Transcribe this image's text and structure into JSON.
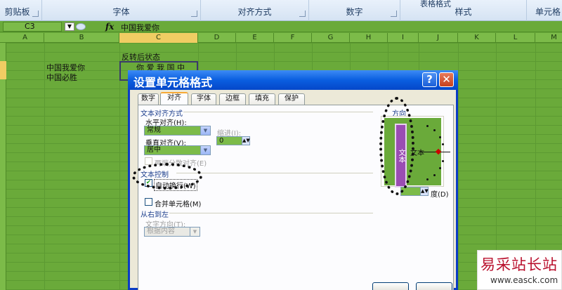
{
  "ribbon": {
    "groups": [
      "剪贴板",
      "字体",
      "对齐方式",
      "数字",
      "样式",
      "单元格"
    ],
    "top_partial": "表格格式"
  },
  "formula_bar": {
    "name_box": "C3",
    "fx": "fx",
    "content": "中国我爱你"
  },
  "columns": [
    "A",
    "B",
    "C",
    "D",
    "E",
    "F",
    "G",
    "H",
    "I",
    "J",
    "K",
    "L",
    "M"
  ],
  "cells": {
    "c_header": "反转后状态",
    "b_row3": "中国我爱你",
    "c_row3": "你 爱 我 国 中",
    "b_row4": "中国必胜"
  },
  "dialog": {
    "title": "设置单元格格式",
    "tabs": [
      "数字",
      "对齐",
      "字体",
      "边框",
      "填充",
      "保护"
    ],
    "active_tab": "对齐",
    "text_align_section": "文本对齐方式",
    "horizontal_label": "水平对齐(H):",
    "horizontal_value": "常规",
    "indent_label": "缩进(I):",
    "indent_value": "0",
    "vertical_label": "垂直对齐(V):",
    "vertical_value": "居中",
    "distributed_label": "两端分散对齐(E)",
    "text_control_section": "文本控制",
    "wrap_label": "自动换行(W)",
    "wrap_checked": "✔",
    "merge_label": "合并单元格(M)",
    "rtl_section": "从右到左",
    "direction_label": "文字方向(T):",
    "direction_value": "根据内容",
    "orientation_section": "方向",
    "vertical_text": "文本",
    "horiz_text": "文本",
    "degree_label": "度(D)",
    "degree_value": ""
  },
  "watermark": {
    "title": "易采站长站",
    "url": "www.easck.com"
  },
  "colors": {
    "grid_green": "#6aaa3a",
    "title_blue": "#0a5ee0",
    "orient_purple": "#9a4db3"
  }
}
